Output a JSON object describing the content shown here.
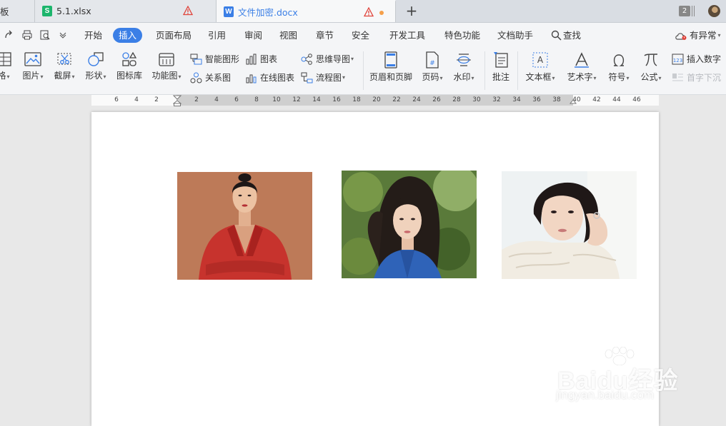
{
  "tabs": [
    {
      "label": "板",
      "icon": "template-icon"
    },
    {
      "label": "5.1.xlsx",
      "icon": "spreadsheet-file-icon",
      "badge": "S",
      "warning": true
    },
    {
      "label": "文件加密.docx",
      "icon": "word-file-icon",
      "badge": "W",
      "warning": true,
      "unsaved": true,
      "active": true
    }
  ],
  "window_count": "2",
  "menu": {
    "items": [
      "开始",
      "插入",
      "页面布局",
      "引用",
      "审阅",
      "视图",
      "章节",
      "安全",
      "开发工具",
      "特色功能",
      "文档助手",
      "查找"
    ],
    "active": "插入",
    "issue_label": "有异常"
  },
  "ribbon": {
    "table": "格",
    "picture": "图片",
    "screenshot": "截屏",
    "shape": "形状",
    "icon_library": "图标库",
    "function_chart": "功能图",
    "smart_art": "智能图形",
    "relation_chart": "关系图",
    "chart": "图表",
    "online_chart": "在线图表",
    "mind_map": "思维导图",
    "flowchart": "流程图",
    "header_footer": "页眉和页脚",
    "page_number": "页码",
    "watermark": "水印",
    "comment": "批注",
    "text_box": "文本框",
    "word_art": "艺术字",
    "symbol": "符号",
    "formula": "公式",
    "insert_number": "插入数字",
    "drop_cap": "首字下沉"
  },
  "ruler": {
    "left_ticks": [
      "6",
      "4",
      "2"
    ],
    "right_ticks": [
      "2",
      "4",
      "6",
      "8",
      "10",
      "12",
      "14",
      "16",
      "18",
      "20",
      "22",
      "24",
      "26",
      "28",
      "30",
      "32",
      "34",
      "36",
      "38",
      "40",
      "42",
      "44",
      "46"
    ]
  },
  "document": {
    "photos": [
      {
        "name": "portrait-red-suit"
      },
      {
        "name": "portrait-blue-shirt"
      },
      {
        "name": "portrait-white-lace"
      }
    ]
  },
  "watermark": {
    "main": "Baidu经验",
    "sub": "jingyan.baidu.com"
  },
  "colors": {
    "accent": "#3b7fe6",
    "spreadsheet_green": "#1cb56c",
    "warning_red": "#e0433a",
    "unsaved_orange": "#f5a04b"
  }
}
